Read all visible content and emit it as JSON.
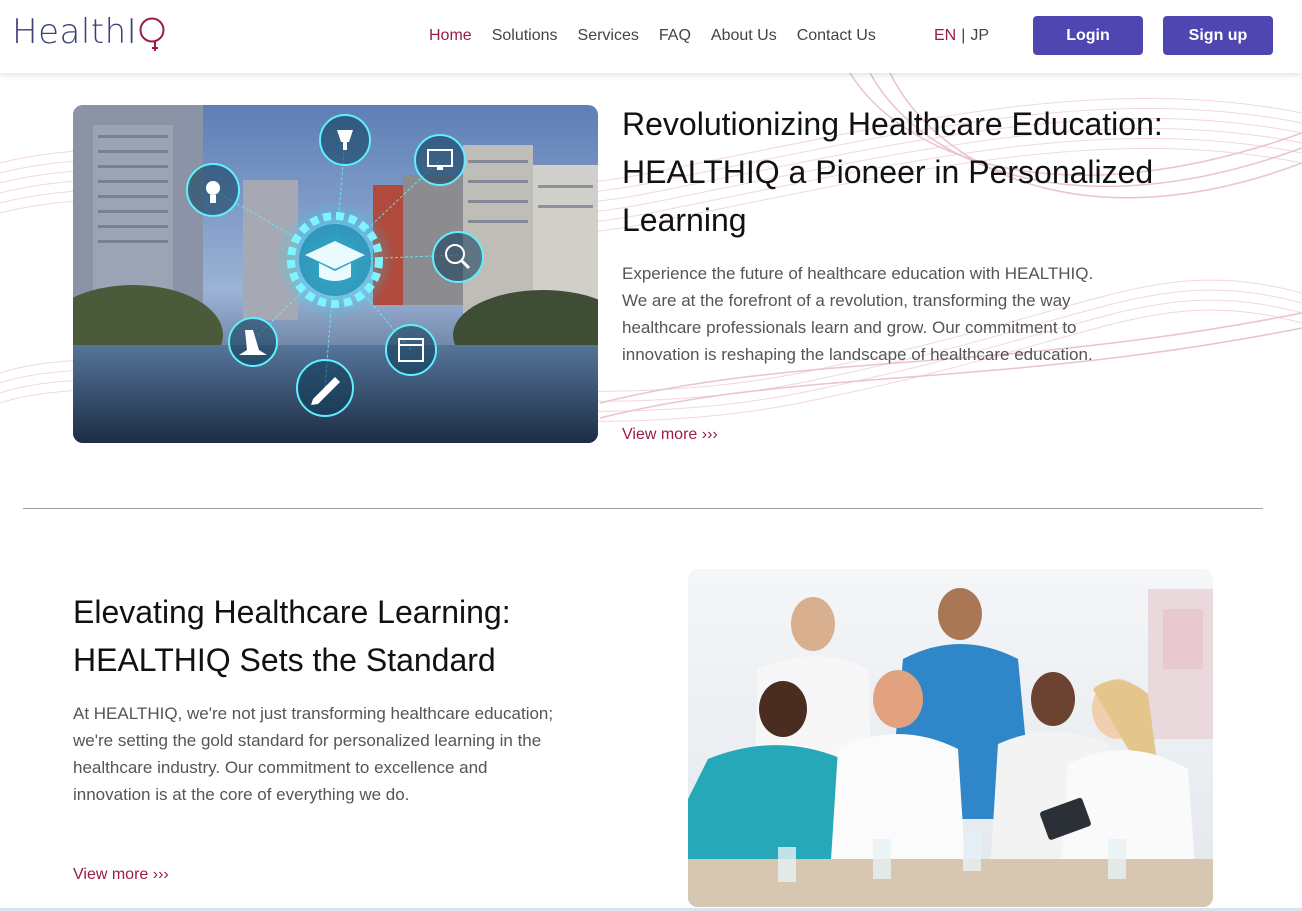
{
  "header": {
    "logo_text": "Health",
    "logo_accent": "IQ",
    "nav": [
      {
        "label": "Home",
        "active": true
      },
      {
        "label": "Solutions",
        "active": false
      },
      {
        "label": "Services",
        "active": false
      },
      {
        "label": "FAQ",
        "active": false
      },
      {
        "label": "About Us",
        "active": false
      },
      {
        "label": "Contact Us",
        "active": false
      }
    ],
    "lang_en": "EN",
    "lang_sep": "|",
    "lang_jp": "JP",
    "login_label": "Login",
    "signup_label": "Sign up"
  },
  "section1": {
    "title": "Revolutionizing Healthcare Education: HEALTHIQ a Pioneer in Personalized Learning",
    "body": "Experience the future of healthcare education with HEALTHIQ. We are at the forefront of a revolution, transforming the way healthcare professionals learn and grow. Our commitment to innovation is reshaping the landscape of healthcare education.",
    "link": "View more ›››"
  },
  "section2": {
    "title": "Elevating Healthcare Learning: HEALTHIQ Sets the Standard",
    "body": "At HEALTHIQ, we're not just transforming healthcare education; we're setting the gold standard for personalized learning in the healthcare industry. Our commitment to excellence and innovation is at the core of everything we do.",
    "link": "View more ›››"
  },
  "colors": {
    "accent": "#9b1b4f",
    "button": "#4f46b1",
    "logo": "#3b3f7a"
  },
  "icons": [
    "graduation-cap-icon",
    "trophy-icon",
    "monitor-icon",
    "lightbulb-icon",
    "search-check-icon",
    "microscope-icon",
    "calendar-icon",
    "pencil-icon"
  ]
}
